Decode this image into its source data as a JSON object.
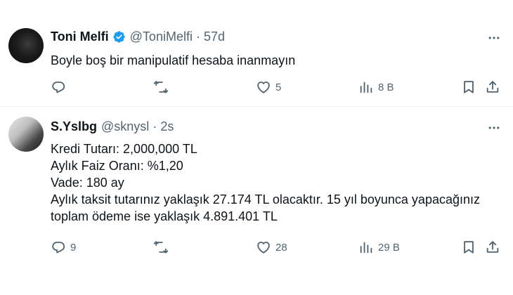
{
  "tweets": [
    {
      "display_name": "Toni Melfi",
      "verified": true,
      "handle": "@ToniMelfi",
      "separator": "·",
      "time": "57d",
      "lines": [
        "Boyle boş bir manipulatif hesaba inanmayın"
      ],
      "replies": "",
      "retweets": "",
      "likes": "5",
      "views": "8 B"
    },
    {
      "display_name": "S.Yslbg",
      "verified": false,
      "handle": "@sknysl",
      "separator": "·",
      "time": "2s",
      "lines": [
        "Kredi Tutarı: 2,000,000 TL",
        "Aylık Faiz Oranı: %1,20",
        "Vade: 180 ay",
        "Aylık taksit tutarınız yaklaşık 27.174 TL olacaktır. 15 yıl boyunca yapacağınız",
        "toplam ödeme ise yaklaşık 4.891.401 TL"
      ],
      "replies": "9",
      "retweets": "",
      "likes": "28",
      "views": "29 B"
    }
  ],
  "icons": {
    "reply": "reply-icon",
    "retweet": "retweet-icon",
    "like": "heart-icon",
    "views": "views-icon",
    "bookmark": "bookmark-icon",
    "share": "share-icon",
    "more": "more-icon",
    "verified": "verified-badge-icon"
  },
  "colors": {
    "text": "#0f1419",
    "secondary": "#536471",
    "verified": "#1d9bf0",
    "divider": "#eff3f4"
  }
}
